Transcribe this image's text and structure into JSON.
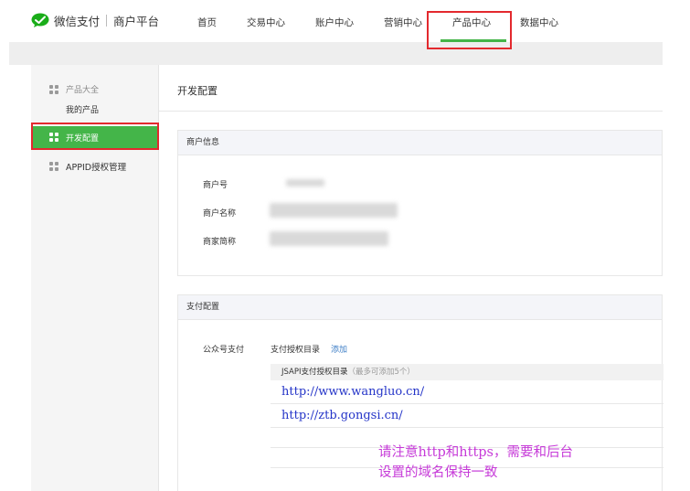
{
  "brand": {
    "name": "微信支付",
    "subtitle": "商户平台",
    "color": "#44b549"
  },
  "nav": {
    "items": [
      {
        "label": "首页"
      },
      {
        "label": "交易中心"
      },
      {
        "label": "账户中心"
      },
      {
        "label": "营销中心"
      },
      {
        "label": "产品中心",
        "active": true
      },
      {
        "label": "数据中心"
      }
    ]
  },
  "sidebar": {
    "group_label": "产品大全",
    "my_products": "我的产品",
    "active_item": "开发配置",
    "appid_item": "APPID授权管理"
  },
  "main": {
    "page_title": "开发配置",
    "merchant_info": {
      "title": "商户信息",
      "fields": [
        {
          "label": "商户号"
        },
        {
          "label": "商户名称"
        },
        {
          "label": "商家简称"
        }
      ]
    },
    "payment_config": {
      "title": "支付配置",
      "official_account_label": "公众号支付",
      "auth_dir_label": "支付授权目录",
      "add_link": "添加",
      "dir_table_title": "JSAPI支付授权目录",
      "dir_table_hint": "（最多可添加5个）",
      "urls": [
        "http://www.wangluo.cn/",
        "http://ztb.gongsi.cn/"
      ]
    }
  },
  "annotation": {
    "line1": "请注意http和https，需要和后台",
    "line2": "设置的域名保持一致",
    "color": "#c63ad8"
  },
  "highlight_color": "#e3292e"
}
